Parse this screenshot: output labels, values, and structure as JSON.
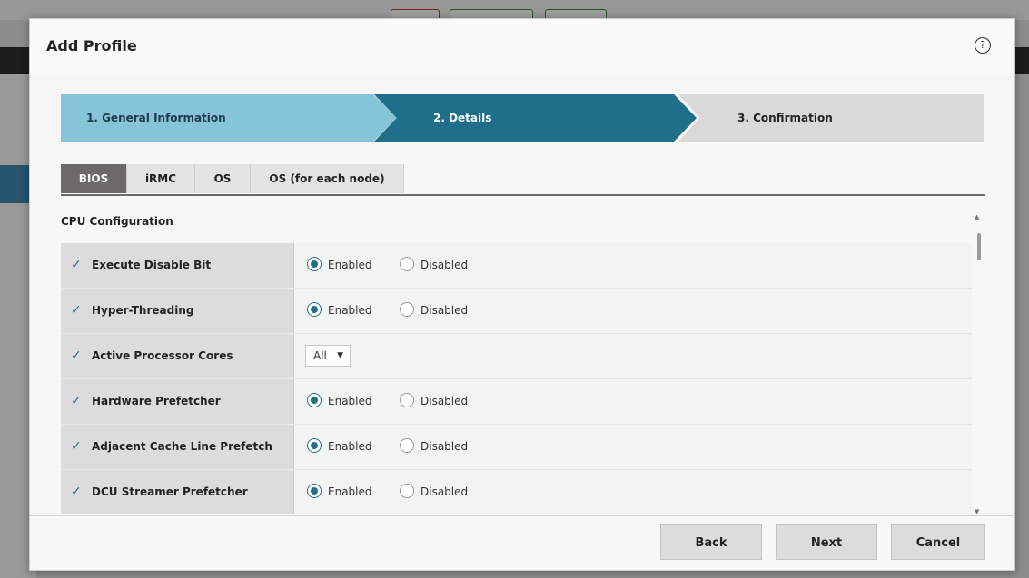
{
  "dialog": {
    "title": "Add Profile",
    "help_icon": "?"
  },
  "steps": [
    {
      "label": "1. General Information"
    },
    {
      "label": "2. Details"
    },
    {
      "label": "3. Confirmation"
    }
  ],
  "tabs": [
    {
      "label": "BIOS"
    },
    {
      "label": "iRMC"
    },
    {
      "label": "OS"
    },
    {
      "label": "OS (for each node)"
    }
  ],
  "section": {
    "title": "CPU Configuration"
  },
  "rows": [
    {
      "label": "Execute Disable Bit",
      "opt1": "Enabled",
      "opt2": "Disabled",
      "selected": "Enabled"
    },
    {
      "label": "Hyper-Threading",
      "opt1": "Enabled",
      "opt2": "Disabled",
      "selected": "Enabled"
    },
    {
      "label": "Active Processor Cores",
      "select_value": "All"
    },
    {
      "label": "Hardware Prefetcher",
      "opt1": "Enabled",
      "opt2": "Disabled",
      "selected": "Enabled"
    },
    {
      "label": "Adjacent Cache Line Prefetch",
      "opt1": "Enabled",
      "opt2": "Disabled",
      "selected": "Enabled"
    },
    {
      "label": "DCU Streamer Prefetcher",
      "opt1": "Enabled",
      "opt2": "Disabled",
      "selected": "Enabled"
    }
  ],
  "footer": {
    "back": "Back",
    "next": "Next",
    "cancel": "Cancel"
  },
  "colors": {
    "accent": "#1f6f8b",
    "step_done": "#86c4d8",
    "tab_active": "#6b6a69"
  }
}
